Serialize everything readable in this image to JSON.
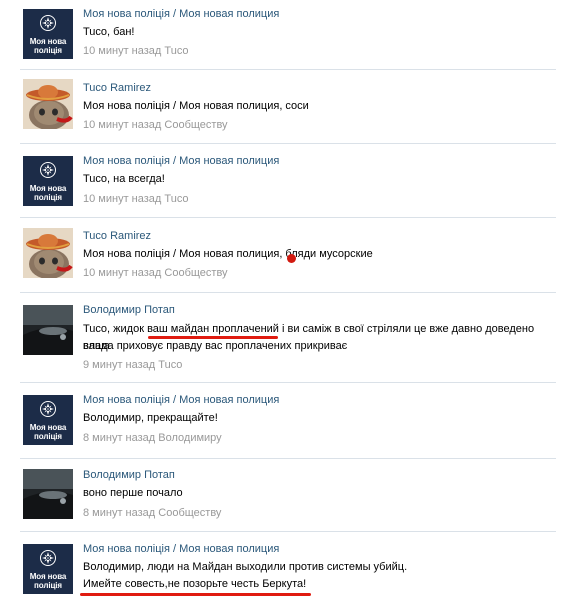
{
  "comments": [
    {
      "author": "Моя нова поліція / Моя новая полиция",
      "text": "Tuco, бан!",
      "time": "10 минут назад",
      "to": "Tuco"
    },
    {
      "author": "Tuco Ramirez",
      "text": "Моя нова поліція / Моя новая полиция, соси",
      "time": "10 минут назад",
      "to": "Сообществу"
    },
    {
      "author": "Моя нова поліція / Моя новая полиция",
      "text": "Tuco, на всегда!",
      "time": "10 минут назад",
      "to": "Tuco"
    },
    {
      "author": "Tuco Ramirez",
      "text": "Моя нова поліція / Моя новая полиция, бляди мусорские",
      "time": "10 минут назад",
      "to": "Сообществу"
    },
    {
      "author": "Володимир Потап",
      "text_line1": "Tuco, жидок ваш майдан проплачений і ви саміж в свої стріляли це вже давно доведено ваша",
      "text_line2": "влада приховує правду вас проплачених прикриває",
      "time": "9 минут назад",
      "to": "Tuco"
    },
    {
      "author": "Моя нова поліція / Моя новая полиция",
      "text": "Володимир, прекращайте!",
      "time": "8 минут назад",
      "to": "Володимиру"
    },
    {
      "author": "Володимир Потап",
      "text": "воно перше почало",
      "time": "8 минут назад",
      "to": "Сообществу"
    },
    {
      "author": "Моя нова поліція / Моя новая полиция",
      "text_line1": "Володимир, люди на Майдан выходили против системы убийц.",
      "text_line2": "Имейте совесть,не позорьте честь Беркута!"
    }
  ],
  "police_avatar": {
    "line1": "Моя нова",
    "line2": "поліція"
  },
  "colors": {
    "link": "#2b587a",
    "meta": "#999999",
    "separator": "#dae1e8",
    "highlight": "#e01b10",
    "police_bg": "#1c2c48"
  }
}
